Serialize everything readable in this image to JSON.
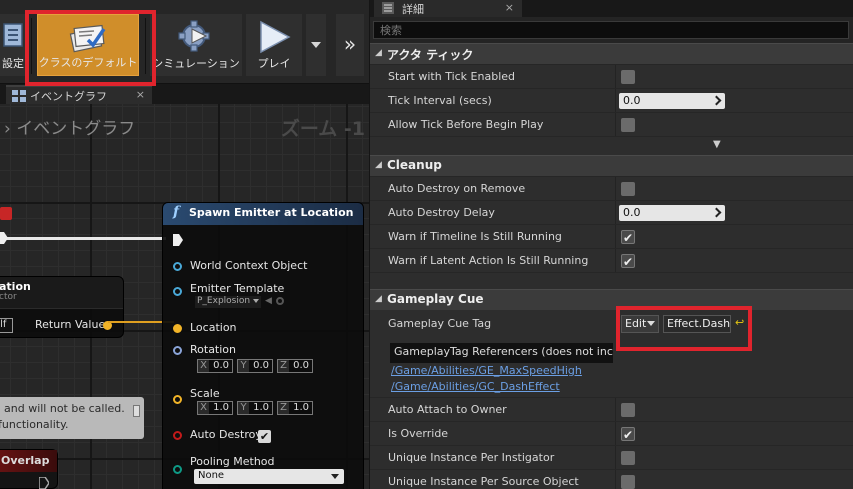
{
  "toolbar": {
    "settings_label": "設定",
    "class_defaults_label": "クラスのデフォルト",
    "simulation_label": "シミュレーション",
    "play_label": "プレイ",
    "more_label": "»"
  },
  "graph_tab": {
    "label": "イベントグラフ",
    "close": "×"
  },
  "graph": {
    "breadcrumb_arrow": "›",
    "breadcrumb": "イベントグラフ",
    "zoom": "ズーム -1",
    "location_node": {
      "title": "ation",
      "subtitle": "ctor",
      "self_label": "elf",
      "return_label": "Return Value"
    },
    "spawn_node": {
      "title": "Spawn Emitter at Location",
      "pins": {
        "world_context": "World Context Object",
        "emitter_template": "Emitter Template",
        "emitter_value": "P_Explosion",
        "location": "Location",
        "rotation": "Rotation",
        "rotation_x": "0.0",
        "rotation_y": "0.0",
        "rotation_z": "0.0",
        "scale": "Scale",
        "scale_x": "1.0",
        "scale_y": "1.0",
        "scale_z": "1.0",
        "auto_destroy": "Auto Destroy",
        "pooling_method": "Pooling Method",
        "pooling_value": "None"
      },
      "axis_x": "X",
      "axis_y": "Y",
      "axis_z": "Z"
    },
    "comment_line1": "and will not be called.",
    "comment_line2": "functionality.",
    "overlap_title": "Overlap"
  },
  "details_tab": {
    "label": "詳細",
    "close": "×"
  },
  "search": {
    "placeholder": "検索"
  },
  "categories": {
    "actor_tick": "アクタ ティック",
    "cleanup": "Cleanup",
    "gameplay_cue": "Gameplay Cue"
  },
  "rows": {
    "start_with_tick": "Start with Tick Enabled",
    "tick_interval": "Tick Interval (secs)",
    "tick_interval_value": "0.0",
    "allow_tick_before": "Allow Tick Before Begin Play",
    "auto_destroy_on_remove": "Auto Destroy on Remove",
    "auto_destroy_delay": "Auto Destroy Delay",
    "auto_destroy_delay_value": "0.0",
    "warn_timeline": "Warn if Timeline Is Still Running",
    "warn_latent": "Warn if Latent Action Is Still Running",
    "gameplay_cue_tag": "Gameplay Cue Tag",
    "auto_attach": "Auto Attach to Owner",
    "is_override": "Is Override",
    "unique_per_instigator": "Unique Instance Per Instigator",
    "unique_per_source": "Unique Instance Per Source Object"
  },
  "gameplay_cue": {
    "edit_label": "Edit",
    "tag_value": "Effect.Dash",
    "referencers_header": "GameplayTag Referencers (does not inc",
    "ref1": "/Game/Abilities/GE_MaxSpeedHigh",
    "ref2": "/Game/Abilities/GC_DashEffect"
  },
  "checkmark": "✔",
  "colors": {
    "highlight_red": "#e0242d",
    "class_defaults_orange": "#d08e2a",
    "link_blue": "#6b9fe4"
  }
}
